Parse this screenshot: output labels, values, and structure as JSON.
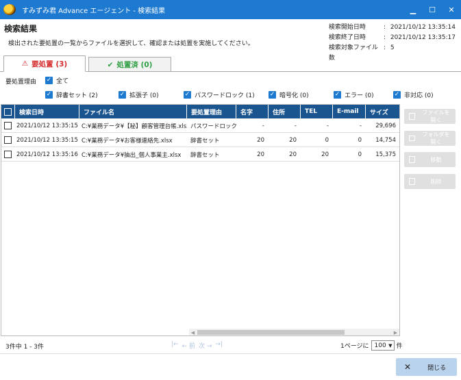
{
  "window": {
    "title": "すみずみ君 Advance エージェント - 検索結果",
    "minimize": "▁",
    "maximize": "☐",
    "close": "✕"
  },
  "header": {
    "title": "検索結果",
    "description": "検出された要処置の一覧からファイルを選択して、確認または処置を実施してください。",
    "meta": [
      {
        "label": "検索開始日時",
        "value": "2021/10/12 13:35:14"
      },
      {
        "label": "検索終了日時",
        "value": "2021/10/12 13:35:17"
      },
      {
        "label": "検索対象ファイル数",
        "value": "5"
      }
    ],
    "sep": ":"
  },
  "tabs": [
    {
      "label": "要処置 (3)",
      "icon": "warning-icon",
      "active": true,
      "color": "#d52a2a"
    },
    {
      "label": "処置済 (0)",
      "icon": "check-icon",
      "active": false,
      "color": "#2f9e44"
    }
  ],
  "filters": {
    "label": "要処置理由",
    "all": "全て",
    "items": [
      {
        "label": "辞書セット (2)",
        "checked": true
      },
      {
        "label": "拡張子 (0)",
        "checked": true
      },
      {
        "label": "パスワードロック (1)",
        "checked": true
      },
      {
        "label": "暗号化 (0)",
        "checked": true
      },
      {
        "label": "エラー (0)",
        "checked": true
      },
      {
        "label": "非対応 (0)",
        "checked": true
      }
    ]
  },
  "table": {
    "columns": [
      "検索日時",
      "ファイル名",
      "要処置理由",
      "名字",
      "住所",
      "TEL",
      "E-mail",
      "サイズ"
    ],
    "rows": [
      [
        "2021/10/12 13:35:15",
        "C:¥業務データ¥【秘】顧客管理台帳.xlsx",
        "パスワードロック",
        "-",
        "-",
        "-",
        "-",
        "29,696"
      ],
      [
        "2021/10/12 13:35:15",
        "C:¥業務データ¥お客様連絡先.xlsx",
        "辞書セット",
        "20",
        "20",
        "0",
        "0",
        "14,754"
      ],
      [
        "2021/10/12 13:35:16",
        "C:¥業務データ¥抽出_個人事業主.xlsx",
        "辞書セット",
        "20",
        "20",
        "20",
        "0",
        "15,375"
      ]
    ]
  },
  "side_buttons": [
    "ファイルを開く",
    "フォルダを開く",
    "移動",
    "削除"
  ],
  "pager": {
    "summary": "3件中 1 - 3件",
    "first": "|←",
    "prev": "← 前",
    "next": "次 →",
    "last": "→|",
    "per_page_label": "1ページに",
    "per_page_value": "100",
    "per_page_suffix": "件"
  },
  "footer": {
    "close_label": "閉じる"
  },
  "colors": {
    "titlebar": "#1d7ad0",
    "grid_header": "#1b5590",
    "accent": "#1d7ad0"
  }
}
